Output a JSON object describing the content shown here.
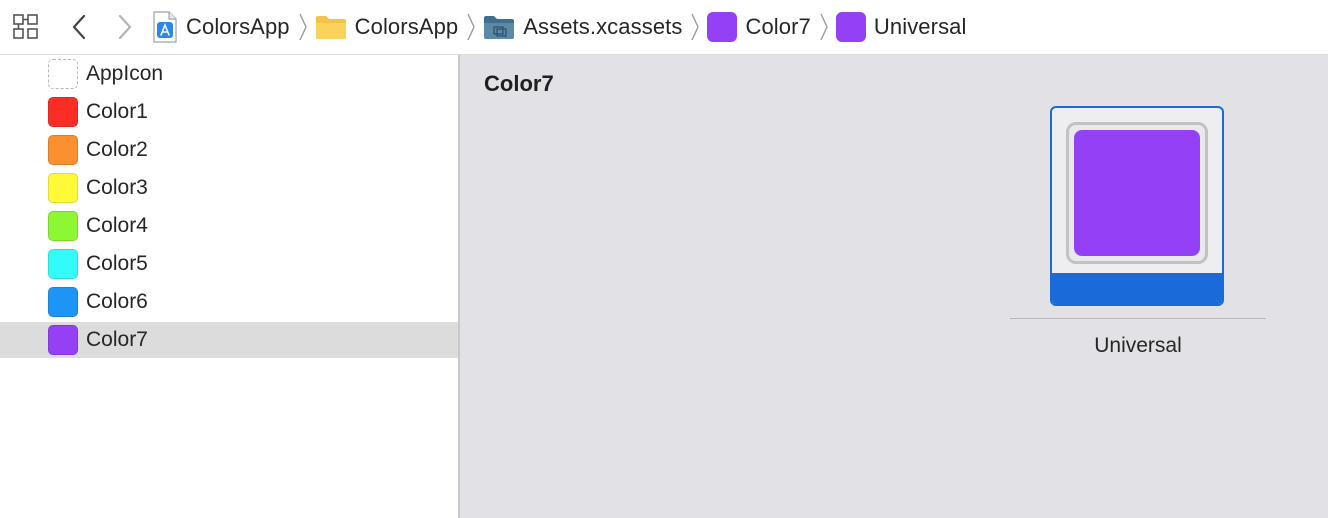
{
  "window": {
    "jump_bar": {
      "crumbs": [
        {
          "label": "ColorsApp",
          "icon": "project-file-icon"
        },
        {
          "label": "ColorsApp",
          "icon": "folder-icon"
        },
        {
          "label": "Assets.xcassets",
          "icon": "asset-catalog-folder-icon"
        },
        {
          "label": "Color7",
          "icon": "color-set-icon",
          "color": "#9440f5"
        },
        {
          "label": "Universal",
          "icon": "color-swatch-icon",
          "color": "#9440f5"
        }
      ]
    },
    "sidebar": {
      "items": [
        {
          "label": "AppIcon",
          "color": null
        },
        {
          "label": "Color1",
          "color": "#fc2d25"
        },
        {
          "label": "Color2",
          "color": "#fc8f2f"
        },
        {
          "label": "Color3",
          "color": "#fefa37"
        },
        {
          "label": "Color4",
          "color": "#8ef733"
        },
        {
          "label": "Color5",
          "color": "#33fcf8"
        },
        {
          "label": "Color6",
          "color": "#1c95f7"
        },
        {
          "label": "Color7",
          "color": "#9440f5",
          "selected": true
        }
      ]
    },
    "editor": {
      "title": "Color7",
      "slot": {
        "label": "Universal",
        "color": "#9440f5"
      }
    },
    "colors": {
      "accent": "#1a6bd9",
      "selection_bg": "#dcdcdc",
      "editor_bg": "#e2e2e6"
    }
  }
}
